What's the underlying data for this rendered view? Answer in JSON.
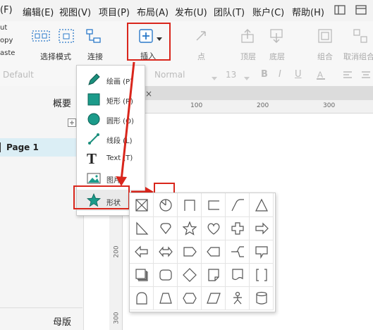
{
  "menubar": {
    "items": [
      {
        "label": "(F)"
      },
      {
        "label": "编辑(E)"
      },
      {
        "label": "视图(V)"
      },
      {
        "label": "项目(P)"
      },
      {
        "label": "布局(A)"
      },
      {
        "label": "发布(U)"
      },
      {
        "label": "团队(T)"
      },
      {
        "label": "账户(C)"
      },
      {
        "label": "帮助(H)"
      }
    ]
  },
  "clipboard": {
    "cut": "ut",
    "copy": "opy",
    "paste": "aste"
  },
  "toolbar": {
    "select_mode": "选择模式",
    "connect": "连接",
    "insert": "插入",
    "point": "点",
    "top_layer": "顶层",
    "bottom_layer": "底层",
    "group": "组合",
    "ungroup": "取消组合"
  },
  "formatbar": {
    "style": "Default",
    "font": "Normal",
    "size": "13"
  },
  "leftpanel": {
    "outline_title": "概要",
    "page1": "Page 1",
    "masters_title": "母版"
  },
  "ruler": {
    "h_ticks": [
      "100",
      "200",
      "300"
    ],
    "v_ticks": [
      "200",
      "300"
    ]
  },
  "insert_menu": {
    "items": [
      {
        "label": "绘画 (P)",
        "icon": "pen-icon"
      },
      {
        "label": "矩形 (R)",
        "icon": "rectangle-icon"
      },
      {
        "label": "圆形 (O)",
        "icon": "circle-icon"
      },
      {
        "label": "线段 (L)",
        "icon": "line-icon"
      },
      {
        "label": "Text (T)",
        "icon": "text-icon"
      },
      {
        "label": "图片",
        "icon": "image-icon"
      },
      {
        "label": "形状",
        "icon": "star-icon"
      }
    ]
  },
  "shapes": [
    "crossed-box",
    "pie",
    "bracket-top",
    "bracket-left",
    "curved-corner",
    "triangle",
    "right-triangle",
    "callout-heart",
    "star",
    "heart",
    "plus",
    "arrow-right",
    "arrow-left",
    "arrow-both",
    "pentagon-right",
    "pentagon-left",
    "branch",
    "callout-down",
    "stacked-doc",
    "rounded-rect",
    "diamond",
    "page-fold",
    "doc-wave",
    "brackets",
    "arch",
    "trapezoid",
    "hexagon",
    "parallelogram",
    "person",
    "cylinder"
  ],
  "colors": {
    "highlight": "#d9261c",
    "selected_page": "#dbeef5"
  }
}
